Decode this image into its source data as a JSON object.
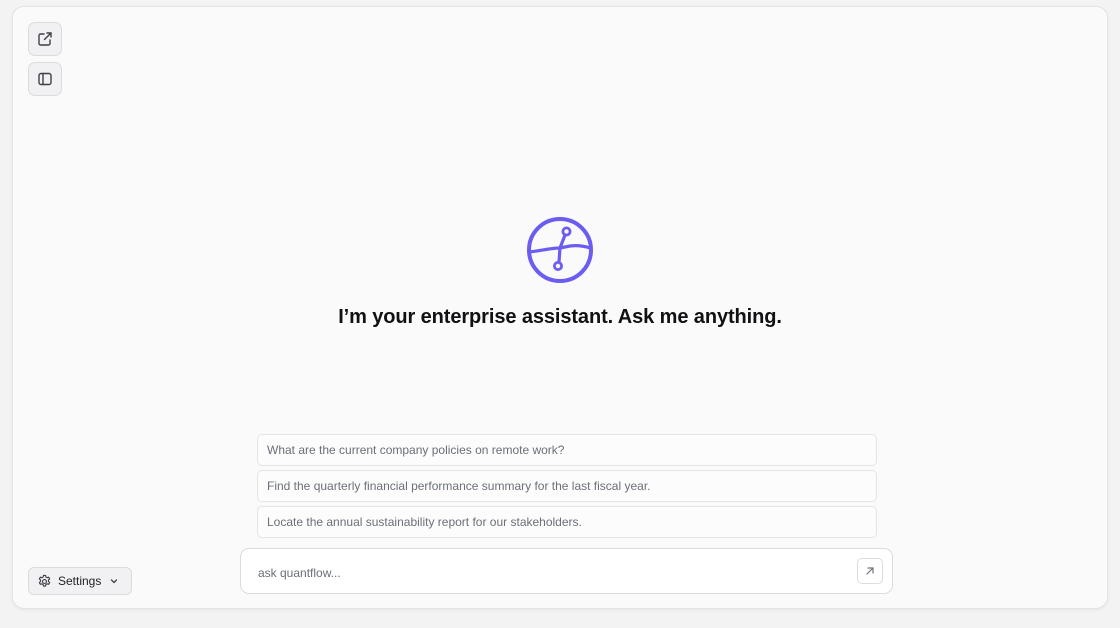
{
  "toolbar": {
    "open_external_icon": "external-link-icon",
    "toggle_sidebar_icon": "sidebar-panel-icon"
  },
  "hero": {
    "logo_icon": "circuit-globe-logo",
    "title": "I’m your enterprise assistant. Ask me anything.",
    "accent_color": "#6b5cf2"
  },
  "suggestions": [
    {
      "text": "What are the current company policies on remote work?"
    },
    {
      "text": "Find the quarterly financial performance summary for the last fiscal year."
    },
    {
      "text": "Locate the annual sustainability report for our stakeholders."
    }
  ],
  "composer": {
    "placeholder": "ask quantflow...",
    "value": "",
    "send_icon": "arrow-up-right-icon"
  },
  "settings": {
    "label": "Settings",
    "icon": "gear-icon",
    "chevron_icon": "chevron-down-icon"
  }
}
